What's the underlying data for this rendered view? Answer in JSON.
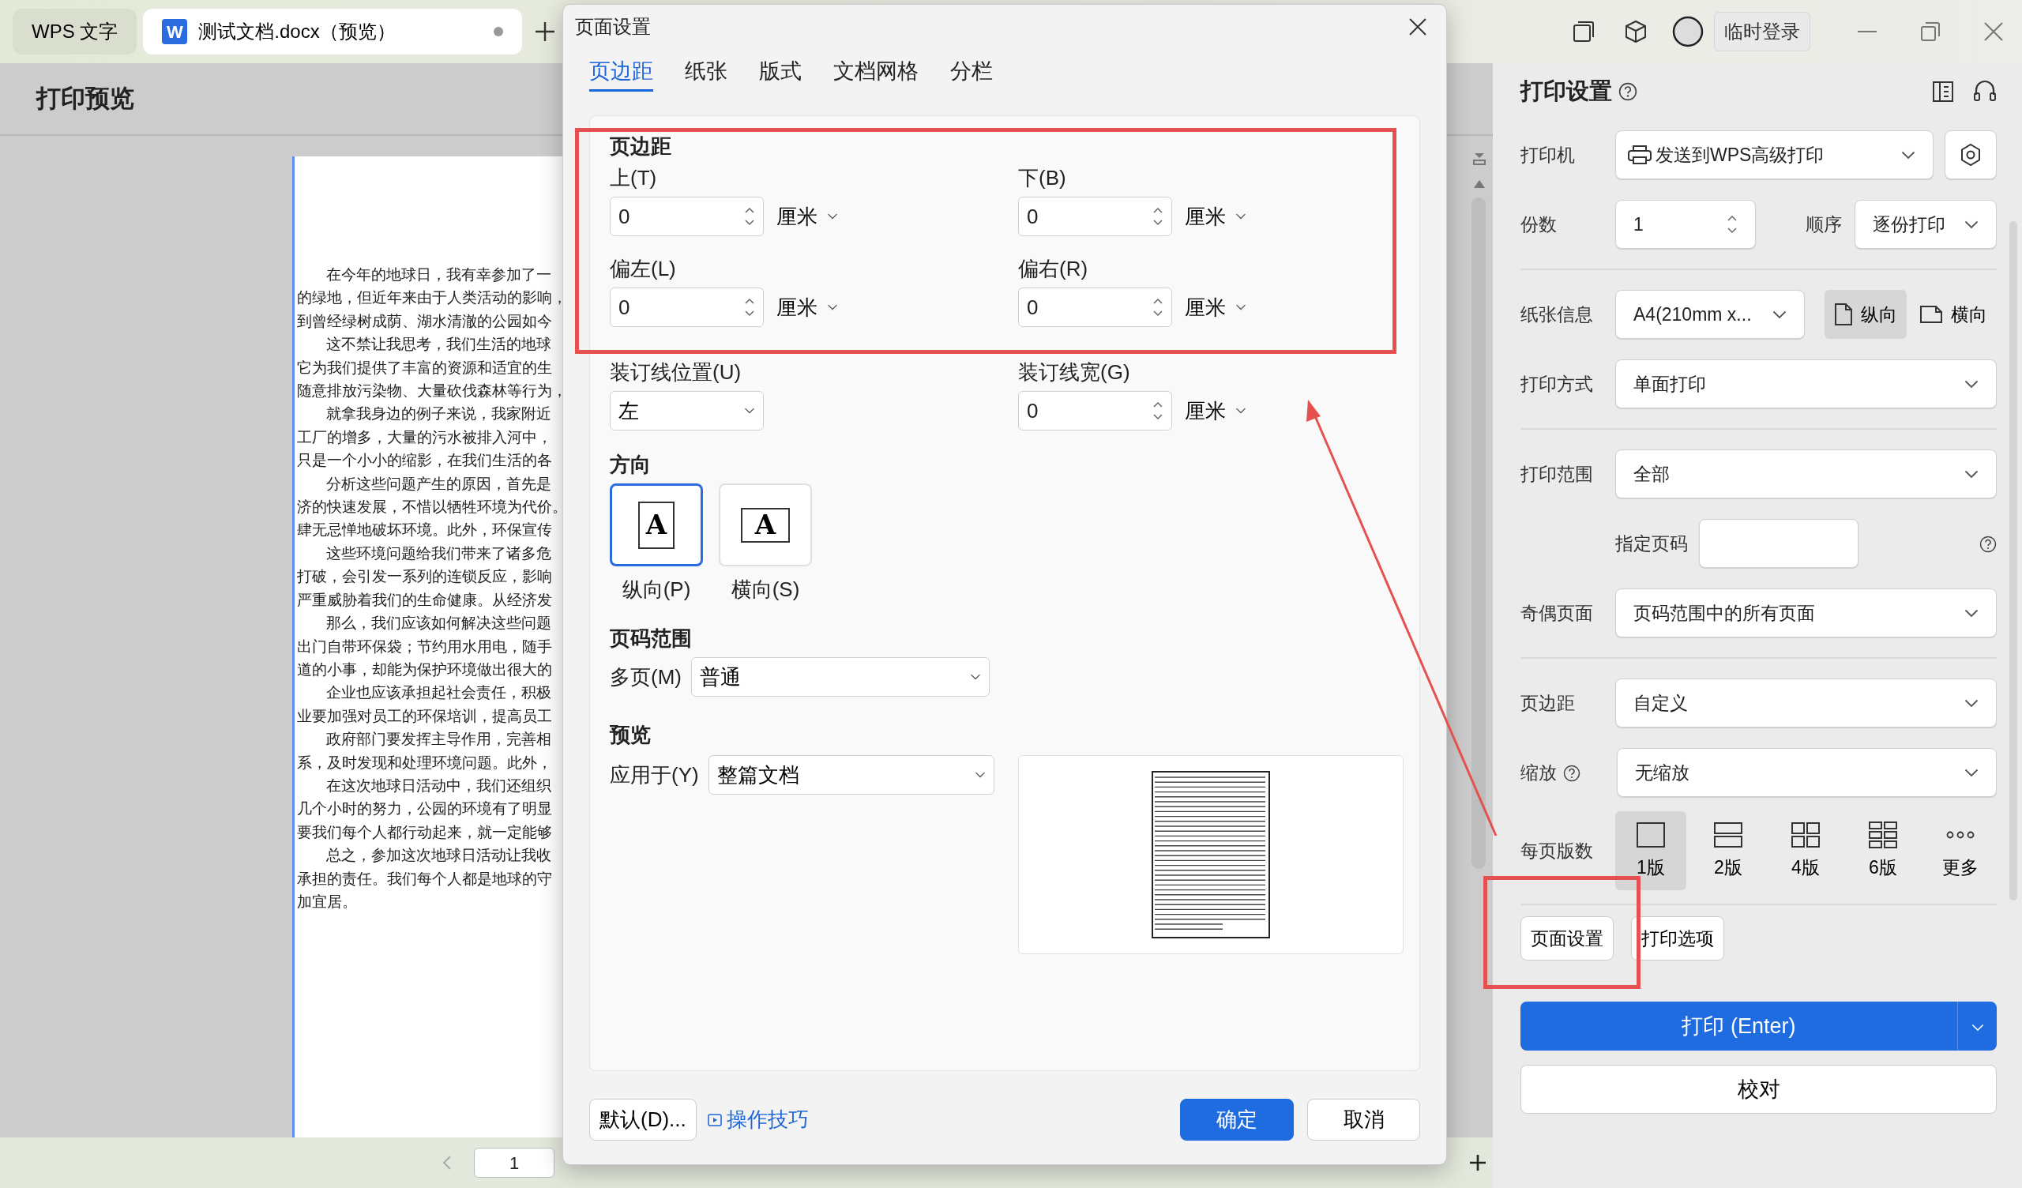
{
  "app_tabs": [
    {
      "kind": "home",
      "label": "WPS 文字",
      "selected": false
    },
    {
      "kind": "doc",
      "logo": "W",
      "label": "测试文档.docx（预览）",
      "selected": true
    }
  ],
  "title_bar": {
    "login_button": "临时登录"
  },
  "preview": {
    "title": "打印预览",
    "paragraphs": [
      [
        "在今年的地球日，我有幸参加了一",
        "的绿地，但近年来由于人类活动的影响，",
        "到曾经绿树成荫、湖水清澈的公园如今"
      ],
      [
        "这不禁让我思考，我们生活的地球",
        "它为我们提供了丰富的资源和适宜的生",
        "随意排放污染物、大量砍伐森林等行为，"
      ],
      [
        "就拿我身边的例子来说，我家附近",
        "工厂的增多，大量的污水被排入河中，",
        "只是一个小小的缩影，在我们生活的各"
      ],
      [
        "分析这些问题产生的原因，首先是",
        "济的快速发展，不惜以牺牲环境为代价。",
        "肆无忌惮地破坏环境。此外，环保宣传"
      ],
      [
        "这些环境问题给我们带来了诸多危",
        "打破，会引发一系列的连锁反应，影响",
        "严重威胁着我们的生命健康。从经济发"
      ],
      [
        "那么，我们应该如何解决这些问题",
        "出门自带环保袋；节约用水用电，随手",
        "道的小事，却能为保护环境做出很大的"
      ],
      [
        "企业也应该承担起社会责任，积极",
        "业要加强对员工的环保培训，提高员工"
      ],
      [
        "政府部门要发挥主导作用，完善相",
        "系，及时发现和处理环境问题。此外，"
      ],
      [
        "在这次地球日活动中，我们还组织",
        "几个小时的努力，公园的环境有了明显",
        "要我们每个人都行动起来，就一定能够"
      ],
      [
        "总之，参加这次地球日活动让我收",
        "承担的责任。我们每个人都是地球的守",
        "加宜居。"
      ]
    ],
    "page_field": "1"
  },
  "print_settings": {
    "title": "打印设置",
    "rows": [
      {
        "kind": "printer",
        "label": "打印机",
        "value": "发送到WPS高级打印"
      },
      {
        "kind": "copies",
        "label": "份数",
        "value": "1",
        "order_label": "顺序",
        "order_value": "逐份打印"
      },
      {
        "kind": "divider"
      },
      {
        "kind": "paper",
        "label": "纸张信息",
        "value": "A4(210mm x...",
        "orientations": [
          {
            "kind": "portrait",
            "label": "纵向",
            "selected": true
          },
          {
            "kind": "landscape",
            "label": "横向",
            "selected": false
          }
        ]
      },
      {
        "kind": "select",
        "label": "打印方式",
        "value": "单面打印"
      },
      {
        "kind": "divider"
      },
      {
        "kind": "select",
        "label": "打印范围",
        "value": "全部"
      },
      {
        "kind": "pages",
        "label": "指定页码"
      },
      {
        "kind": "select",
        "label": "奇偶页面",
        "value": "页码范围中的所有页面"
      },
      {
        "kind": "divider"
      },
      {
        "kind": "select",
        "label": "页边距",
        "value": "自定义"
      },
      {
        "kind": "select",
        "label": "缩放",
        "value": "无缩放",
        "help": true
      },
      {
        "kind": "layout",
        "label": "每页版数",
        "options": [
          {
            "kind": "one",
            "label": "1版",
            "selected": true
          },
          {
            "kind": "two",
            "label": "2版",
            "selected": false
          },
          {
            "kind": "four",
            "label": "4版",
            "selected": false
          },
          {
            "kind": "six",
            "label": "6版",
            "selected": false
          },
          {
            "kind": "more",
            "label": "更多",
            "selected": false
          }
        ]
      },
      {
        "kind": "divider"
      }
    ],
    "buttons": [
      "页面设置",
      "打印选项"
    ],
    "print_button": "打印 (Enter)",
    "proof_button": "校对"
  },
  "dialog": {
    "title": "页面设置",
    "tabs": [
      {
        "label": "页边距",
        "selected": true
      },
      {
        "label": "纸张",
        "selected": false
      },
      {
        "label": "版式",
        "selected": false
      },
      {
        "label": "文档网格",
        "selected": false
      },
      {
        "label": "分栏",
        "selected": false
      }
    ],
    "margins_heading": "页边距",
    "fields": [
      {
        "kind": "number",
        "label": "上(T)",
        "value": "0",
        "unit": "厘米"
      },
      {
        "kind": "number",
        "label": "下(B)",
        "value": "0",
        "unit": "厘米"
      },
      {
        "kind": "number",
        "label": "偏左(L)",
        "value": "0",
        "unit": "厘米"
      },
      {
        "kind": "number",
        "label": "偏右(R)",
        "value": "0",
        "unit": "厘米"
      },
      {
        "kind": "select",
        "label": "装订线位置(U)",
        "value": "左"
      },
      {
        "kind": "number",
        "label": "装订线宽(G)",
        "value": "0",
        "unit": "厘米"
      }
    ],
    "orientation": {
      "heading": "方向",
      "options": [
        {
          "kind": "portrait",
          "glyph": "A",
          "label": "纵向(P)",
          "selected": true
        },
        {
          "kind": "landscape",
          "glyph": "A",
          "label": "横向(S)",
          "selected": false
        }
      ]
    },
    "page_range": {
      "heading": "页码范围",
      "label": "多页(M)",
      "value": "普通"
    },
    "preview": {
      "heading": "预览",
      "label": "应用于(Y)",
      "value": "整篇文档"
    },
    "footer": {
      "default_button": "默认(D)...",
      "tips_link": "操作技巧",
      "ok_button": "确定",
      "cancel_button": "取消"
    }
  }
}
